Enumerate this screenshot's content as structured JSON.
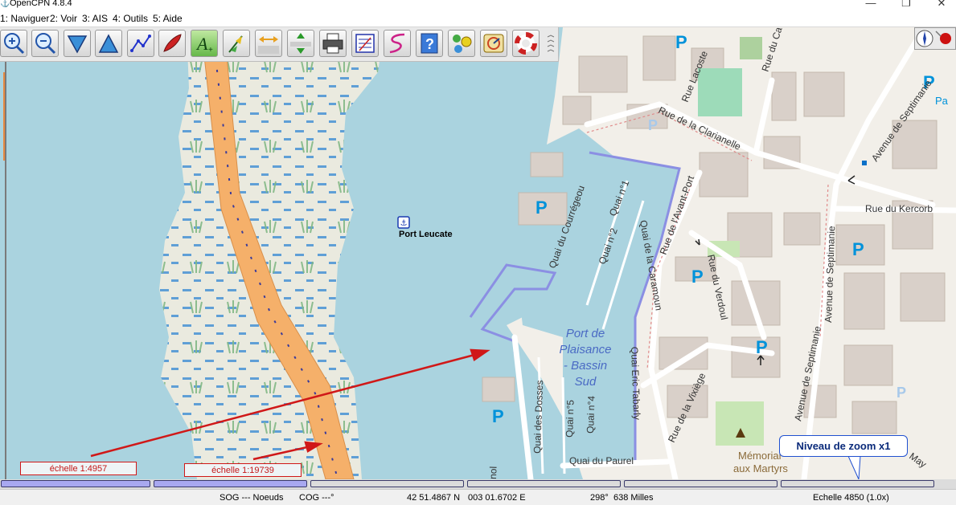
{
  "window": {
    "title": "OpenCPN 4.8.4",
    "minimize": "—",
    "maximize": "❐",
    "close": "✕"
  },
  "menu": [
    "1: Naviguer",
    "2: Voir",
    "3: AIS",
    "4: Outils",
    "5: Aide"
  ],
  "toolbar": {
    "buttons": [
      "zoom-in-icon",
      "zoom-out-icon",
      "scale-down-icon",
      "scale-up-icon",
      "route-icon",
      "auto-follow-icon",
      "text-icon",
      "tide-icon",
      "width-icon",
      "height-icon",
      "print-icon",
      "route-manager-icon",
      "track-icon",
      "help-icon",
      "options-icon",
      "ais-icon",
      "mob-icon"
    ]
  },
  "map": {
    "port_label": "Port Leucate",
    "water_label_lines": [
      "Port de",
      "Plaisance",
      "- Bassin",
      "Sud"
    ],
    "streets": {
      "rue_lacoste": "Rue Lacoste",
      "rue_du_ca": "Rue du Ca",
      "rue_clarianelle": "Rue de la Clarianelle",
      "avenue_septimanie_1": "Avenue de Septimanie",
      "avenue_septimanie_2": "Avenue de Septimanie",
      "avenue_septimanie_3": "Avenue de Septimanie",
      "rue_kercorb": "Rue du Kercorb",
      "rue_avant_port": "Rue de l'Avant-Port",
      "quai_courregeou": "Quai du Courrégeou",
      "quai_1": "Quai n°1",
      "quai_2": "Quai n°2",
      "quai_caramoun": "Quai de la Caramoun",
      "rue_verdoul": "Rue du Verdoul",
      "quai_tabarly": "Quai Eric Tabarly",
      "rue_vixiege": "Rue de la Vixiège",
      "quai_dosses": "Quai des Dosses",
      "quai_5": "Quai n°5",
      "quai_4": "Quai n°4",
      "quai_paurel": "Quai du Paurel",
      "memorial_1": "Mémorial",
      "memorial_2": "aux Martyrs",
      "pa": "Pa",
      "may": "May",
      "nol": "nol"
    },
    "parking": "P"
  },
  "annotations": {
    "scale1": "échelle 1:4957",
    "scale2": "échelle 1:19739",
    "zoom": "Niveau de zoom x1"
  },
  "status": {
    "sog": "SOG --- Noeuds",
    "cog": "COG ---°",
    "lat": "42 51.4867 N",
    "lon": "003 01.6702 E",
    "brg": "298°",
    "dist": "638 Milles",
    "scale": "Echelle 4850 (1.0x)"
  },
  "colors": {
    "water": "#aad3df",
    "land": "#f2efe9",
    "road": "#ffffff",
    "highway": "#f5b06a",
    "annotation_red": "#d01818",
    "callout_blue": "#2050d0"
  }
}
